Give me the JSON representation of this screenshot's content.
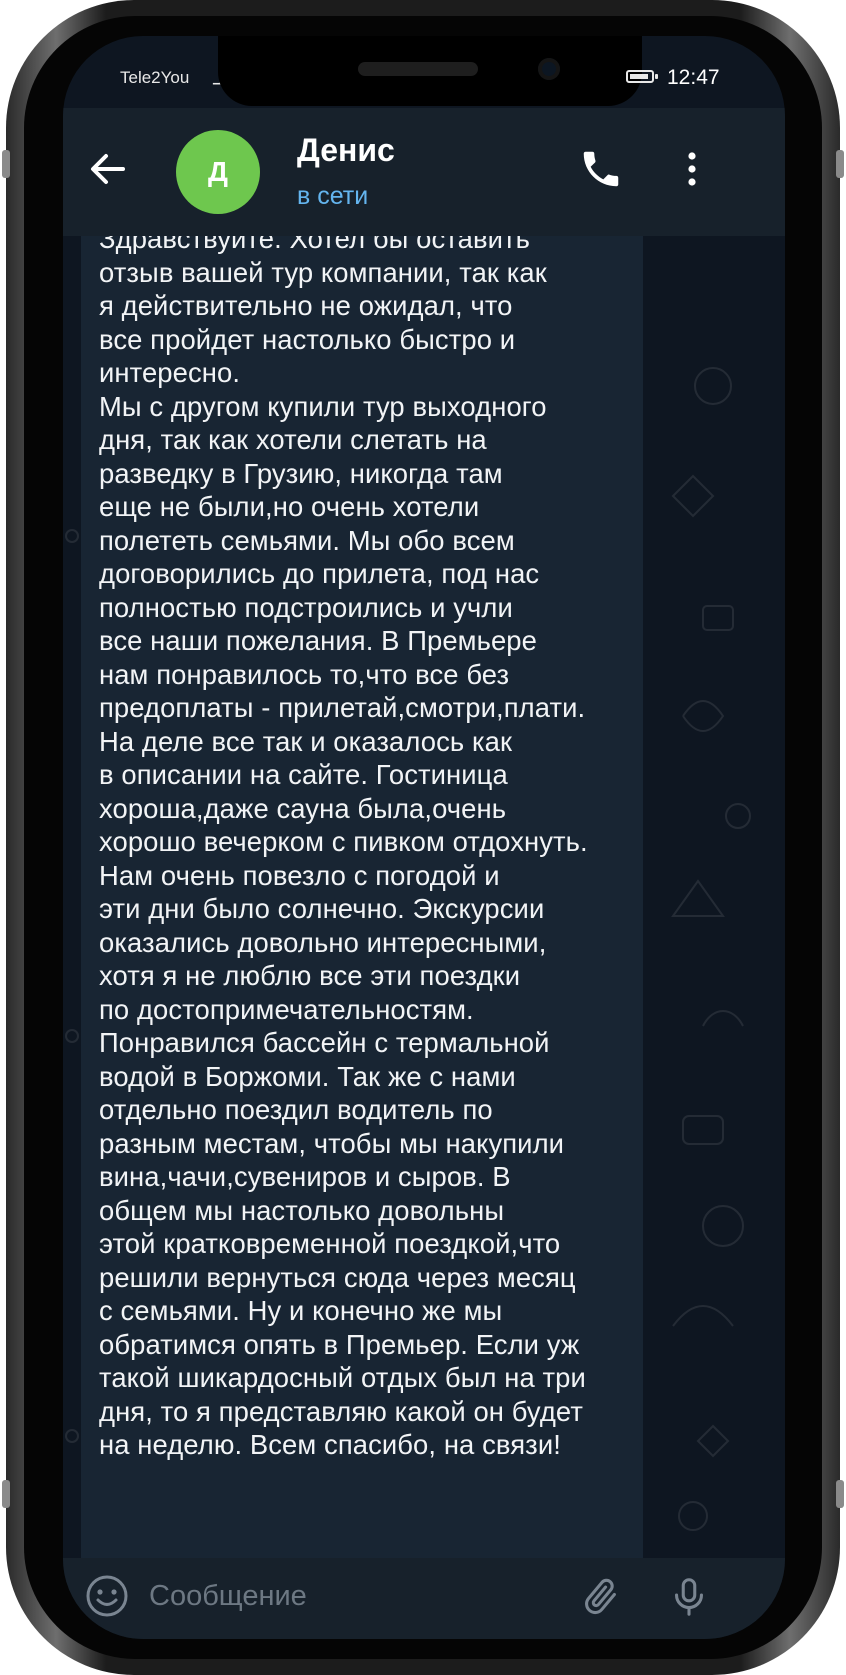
{
  "status_bar": {
    "carrier": "Tele2You",
    "time": "12:47",
    "battery_level": 0.9
  },
  "header": {
    "avatar_letter": "Д",
    "contact_name": "Денис",
    "contact_status": "в сети",
    "icons": {
      "back": "arrow-left-icon",
      "call": "phone-icon",
      "menu": "more-vertical-icon"
    }
  },
  "message": {
    "text": "Здравствуйте. Хотел бы оставить\nотзыв вашей тур компании, так как\nя действительно не ожидал, что\nвсе пройдет настолько быстро и\nинтересно.\nМы с другом купили тур выходного\nдня, так как хотели слетать на\nразведку в Грузию, никогда там\nеще не были,но очень хотели\nполететь семьями. Мы обо всем\nдоговорились до прилета, под нас\nполностью подстроились и учли\nвсе наши пожелания. В Премьере\nнам понравилось то,что все без\nпредоплаты - прилетай,смотри,плати.\nНа деле все так и оказалось как\nв описании на сайте. Гостиница\nхороша,даже сауна была,очень\nхорошо вечерком с пивком отдохнуть.\nНам очень повезло с погодой и\nэти дни было солнечно. Экскурсии\nоказались довольно интересными,\nхотя я не люблю все эти поездки\nпо достопримечательностям.\nПонравился бассейн с термальной\nводой в Боржоми. Так же с нами\nотдельно поездил водитель по\nразным местам, чтобы мы накупили\nвина,чачи,сувениров и сыров. В\nобщем мы настолько довольны\nэтой кратковременной поездкой,что\nрешили вернуться сюда через месяц\nс семьями. Ну и конечно же мы\nобратимся опять в Премьер. Если уж\nтакой шикардосный отдых был на три\nдня, то я представляю какой он будет\nна неделю. Всем спасибо, на связи!"
  },
  "input_bar": {
    "placeholder": "Сообщение",
    "value": "",
    "icons": {
      "emoji": "emoji-icon",
      "attach": "paperclip-icon",
      "mic": "microphone-icon"
    }
  },
  "colors": {
    "background": "#0e1621",
    "header": "#17212b",
    "bubble": "#182533",
    "accent": "#64b5ef",
    "avatar": "#6ec74e"
  }
}
